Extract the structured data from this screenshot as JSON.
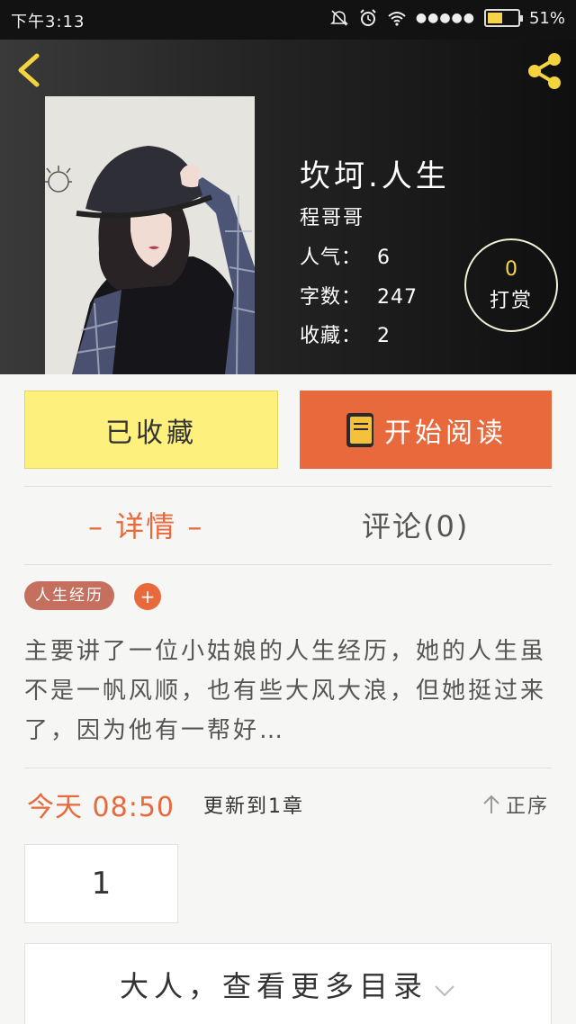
{
  "status_bar": {
    "time": "下午3:13",
    "signal_dots": "●●●●●",
    "battery_level": 0.51,
    "battery_text": "51%"
  },
  "book": {
    "title": "坎坷.人生",
    "author": "程哥哥",
    "stats": [
      {
        "label": "人气：",
        "value": "6"
      },
      {
        "label": "字数：",
        "value": "247"
      },
      {
        "label": "收藏：",
        "value": "2"
      }
    ],
    "reward": {
      "count": "0",
      "label": "打赏"
    }
  },
  "actions": {
    "favorite_label": "已收藏",
    "read_label": "开始阅读"
  },
  "tabs": {
    "details": "– 详情 –",
    "comments": "评论(0)"
  },
  "tags": [
    "人生经历"
  ],
  "tag_add": "+",
  "description": "主要讲了一位小姑娘的人生经历，她的人生虽不是一帆风顺，也有些大风大浪，但她挺过来了，因为他有一帮好…",
  "update": {
    "time": "今天 08:50",
    "text": "更新到1章",
    "sort_label": "正序"
  },
  "chapters": [
    "1"
  ],
  "more_catalog": "大人，查看更多目录",
  "colors": {
    "accent": "#e8693c",
    "favorite_bg": "#fdf07c",
    "reward_num": "#f7d44c",
    "tag_bg": "#c5705e"
  },
  "icons": [
    "back-arrow-icon",
    "share-icon",
    "book-icon",
    "arrow-up-icon",
    "chevron-down-icon",
    "mute-icon",
    "alarm-icon",
    "wifi-icon",
    "battery-icon"
  ]
}
